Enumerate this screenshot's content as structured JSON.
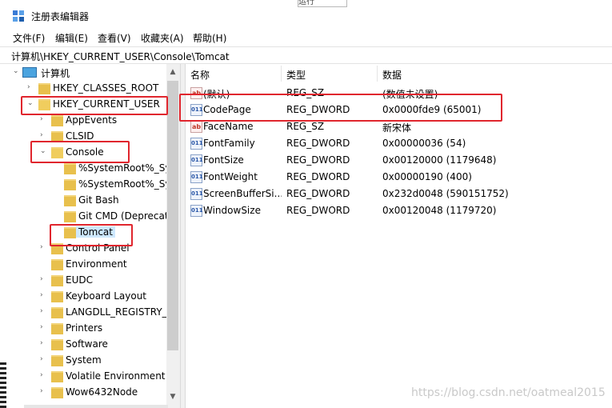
{
  "window": {
    "title": "注册表编辑器",
    "bg_fragment": "运行"
  },
  "menu": [
    "文件(F)",
    "编辑(E)",
    "查看(V)",
    "收藏夹(A)",
    "帮助(H)"
  ],
  "address": "计算机\\HKEY_CURRENT_USER\\Console\\Tomcat",
  "tree": [
    {
      "label": "计算机",
      "type": "computer",
      "expanded": true
    },
    {
      "label": "HKEY_CLASSES_ROOT"
    },
    {
      "label": "HKEY_CURRENT_USER",
      "expanded": true
    },
    {
      "label": "AppEvents"
    },
    {
      "label": "CLSID"
    },
    {
      "label": "Console",
      "expanded": true
    },
    {
      "label": "%SystemRoot%_Sy"
    },
    {
      "label": "%SystemRoot%_Sy"
    },
    {
      "label": "Git Bash"
    },
    {
      "label": "Git CMD (Deprecat"
    },
    {
      "label": "Tomcat",
      "selected": true
    },
    {
      "label": "Control Panel"
    },
    {
      "label": "Environment"
    },
    {
      "label": "EUDC"
    },
    {
      "label": "Keyboard Layout"
    },
    {
      "label": "LANGDLL_REGISTRY_I"
    },
    {
      "label": "Printers"
    },
    {
      "label": "Software"
    },
    {
      "label": "System"
    },
    {
      "label": "Volatile Environment"
    },
    {
      "label": "Wow6432Node"
    }
  ],
  "columns": {
    "name": "名称",
    "type": "类型",
    "data": "数据"
  },
  "values": [
    {
      "icon": "ab",
      "name": "(默认)",
      "type": "REG_SZ",
      "data": "(数值未设置)"
    },
    {
      "icon": "bin",
      "name": "CodePage",
      "type": "REG_DWORD",
      "data": "0x0000fde9 (65001)"
    },
    {
      "icon": "ab",
      "name": "FaceName",
      "type": "REG_SZ",
      "data": "新宋体"
    },
    {
      "icon": "bin",
      "name": "FontFamily",
      "type": "REG_DWORD",
      "data": "0x00000036 (54)"
    },
    {
      "icon": "bin",
      "name": "FontSize",
      "type": "REG_DWORD",
      "data": "0x00120000 (1179648)"
    },
    {
      "icon": "bin",
      "name": "FontWeight",
      "type": "REG_DWORD",
      "data": "0x00000190 (400)"
    },
    {
      "icon": "bin",
      "name": "ScreenBufferSi...",
      "type": "REG_DWORD",
      "data": "0x232d0048 (590151752)"
    },
    {
      "icon": "bin",
      "name": "WindowSize",
      "type": "REG_DWORD",
      "data": "0x00120048 (1179720)"
    }
  ],
  "watermark": "https://blog.csdn.net/oatmeal2015",
  "colors": {
    "highlight": "#e0262e",
    "selection": "#cde8ff",
    "folder": "#e8c04d"
  }
}
